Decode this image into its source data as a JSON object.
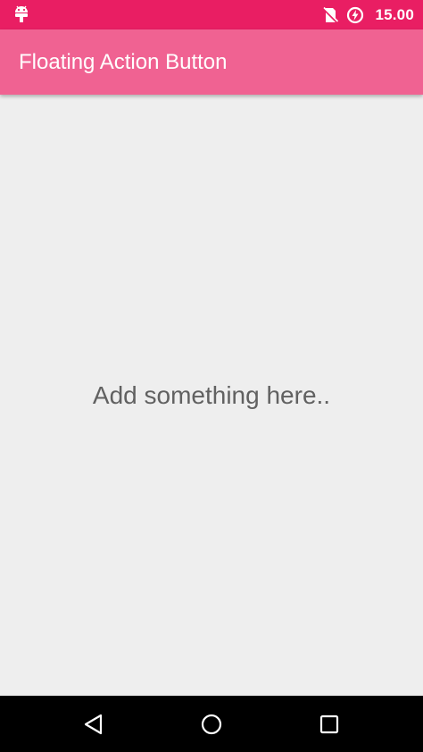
{
  "status_bar": {
    "time": "15.00",
    "icons": [
      "android-debug-icon",
      "no-sim-icon",
      "battery-charging-icon"
    ],
    "color": "#e91e63"
  },
  "app_bar": {
    "title": "Floating Action Button",
    "color": "#f06292"
  },
  "content": {
    "placeholder_text": "Add something here.."
  },
  "nav_bar": {
    "buttons": [
      "back-icon",
      "home-icon",
      "recents-icon"
    ]
  }
}
